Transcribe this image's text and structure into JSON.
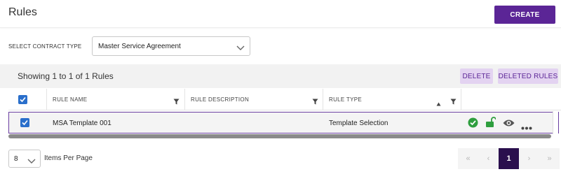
{
  "header": {
    "title": "Rules",
    "create_label": "CREATE"
  },
  "filter": {
    "label": "SELECT CONTRACT TYPE",
    "selected": "Master Service Agreement"
  },
  "toolbar": {
    "showing_text": "Showing 1 to 1 of 1 Rules",
    "delete_label": "DELETE",
    "deleted_rules_label": "DELETED RULES"
  },
  "columns": [
    {
      "label": "RULE NAME"
    },
    {
      "label": "RULE DESCRIPTION"
    },
    {
      "label": "RULE TYPE"
    }
  ],
  "rows": [
    {
      "checked": true,
      "rule_name": "MSA Template 001",
      "rule_description": "",
      "rule_type": "Template Selection"
    }
  ],
  "actions": [
    "check-circle-icon",
    "unlock-icon",
    "eye-icon",
    "more-icon"
  ],
  "pagination": {
    "items_per_page": "8",
    "items_per_page_label": "Items Per Page",
    "first": "«",
    "prev": "‹",
    "current_page": "1",
    "next": "›",
    "last": "»"
  },
  "colors": {
    "brand": "#5b2596",
    "success": "#2e9e3e",
    "checkbox": "#2a6fcb"
  }
}
